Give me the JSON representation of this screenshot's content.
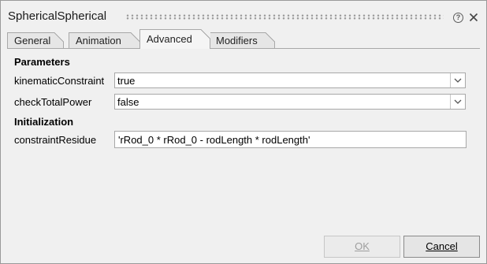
{
  "window": {
    "title": "SphericalSpherical",
    "help_glyph": "?"
  },
  "tabs": [
    {
      "label": "General",
      "active": false
    },
    {
      "label": "Animation",
      "active": false
    },
    {
      "label": "Advanced",
      "active": true
    },
    {
      "label": "Modifiers",
      "active": false
    }
  ],
  "parameters": {
    "header": "Parameters",
    "rows": [
      {
        "label": "kinematicConstraint",
        "value": "true"
      },
      {
        "label": "checkTotalPower",
        "value": "false"
      }
    ]
  },
  "initialization": {
    "header": "Initialization",
    "rows": [
      {
        "label": "constraintResidue",
        "value": "'rRod_0 * rRod_0 - rodLength * rodLength'"
      }
    ]
  },
  "buttons": {
    "ok": "OK",
    "cancel": "Cancel"
  },
  "icons": {
    "help": "help-icon",
    "close": "close-icon",
    "dropdown": "chevron-down-icon"
  }
}
